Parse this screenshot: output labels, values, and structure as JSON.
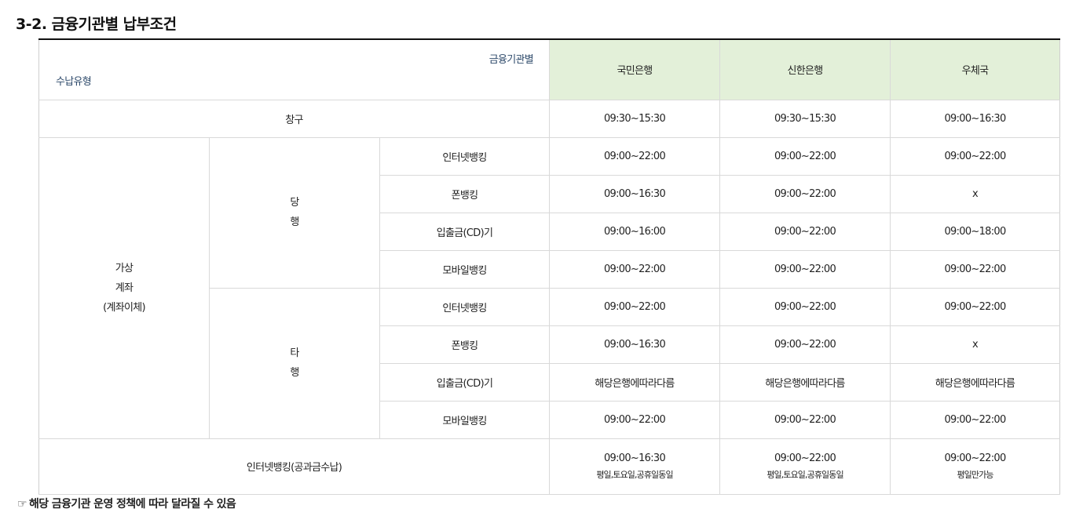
{
  "heading": "3-2. 금융기관별 납부조건",
  "table": {
    "corner_top": "금융기관별",
    "corner_bottom": "수납유형",
    "banks": [
      "국민은행",
      "신한은행",
      "우체국"
    ],
    "window": {
      "label": "창구",
      "values": [
        "09:30~15:30",
        "09:30~15:30",
        "09:00~16:30"
      ]
    },
    "virtual_account": {
      "label_lines": [
        "가상",
        "계좌",
        "(계좌이체)"
      ],
      "groups": [
        {
          "label_lines": [
            "당",
            "행"
          ],
          "rows": [
            {
              "channel": "인터넷뱅킹",
              "values": [
                "09:00~22:00",
                "09:00~22:00",
                "09:00~22:00"
              ]
            },
            {
              "channel": "폰뱅킹",
              "values": [
                "09:00~16:30",
                "09:00~22:00",
                "x"
              ]
            },
            {
              "channel": "입출금(CD)기",
              "values": [
                "09:00~16:00",
                "09:00~22:00",
                "09:00~18:00"
              ]
            },
            {
              "channel": "모바일뱅킹",
              "values": [
                "09:00~22:00",
                "09:00~22:00",
                "09:00~22:00"
              ]
            }
          ]
        },
        {
          "label_lines": [
            "타",
            "행"
          ],
          "rows": [
            {
              "channel": "인터넷뱅킹",
              "values": [
                "09:00~22:00",
                "09:00~22:00",
                "09:00~22:00"
              ]
            },
            {
              "channel": "폰뱅킹",
              "values": [
                "09:00~16:30",
                "09:00~22:00",
                "x"
              ]
            },
            {
              "channel": "입출금(CD)기",
              "values": [
                "해당은행에따라다름",
                "해당은행에따라다름",
                "해당은행에따라다름"
              ]
            },
            {
              "channel": "모바일뱅킹",
              "values": [
                "09:00~22:00",
                "09:00~22:00",
                "09:00~22:00"
              ]
            }
          ]
        }
      ]
    },
    "public_payment": {
      "label": "인터넷뱅킹(공과금수납)",
      "values": [
        {
          "time": "09:00~16:30",
          "note": "평일,토요일,공휴일동일"
        },
        {
          "time": "09:00~22:00",
          "note": "평일,토요일,공휴일동일"
        },
        {
          "time": "09:00~22:00",
          "note": "평일만가능"
        }
      ]
    }
  },
  "footnote": {
    "icon": "pointing-hand-icon",
    "text": "해당 금융기관 운영 정책에 따라 달라질 수 있음"
  },
  "colors": {
    "header_bg": "#e3f0d9",
    "header_text": "#1f2f45",
    "corner_text": "#2e4a6b",
    "border": "#d9d9d9"
  }
}
